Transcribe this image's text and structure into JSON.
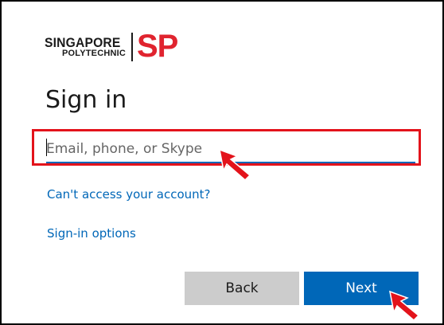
{
  "logo": {
    "line1": "SINGAPORE",
    "line2": "POLYTECHNIC",
    "mark": "SP",
    "mark_color": "#e0242f"
  },
  "title": "Sign in",
  "email": {
    "placeholder": "Email, phone, or Skype",
    "value": ""
  },
  "links": {
    "cant_access": "Can't access your account?",
    "sign_in_options": "Sign-in options"
  },
  "buttons": {
    "back": "Back",
    "next": "Next"
  },
  "colors": {
    "accent": "#0067b8",
    "highlight": "#e3131b",
    "back_button": "#cccccc"
  },
  "icons": {
    "input_annotation": "red-pointer-arrow-icon",
    "next_annotation": "red-pointer-arrow-icon"
  }
}
